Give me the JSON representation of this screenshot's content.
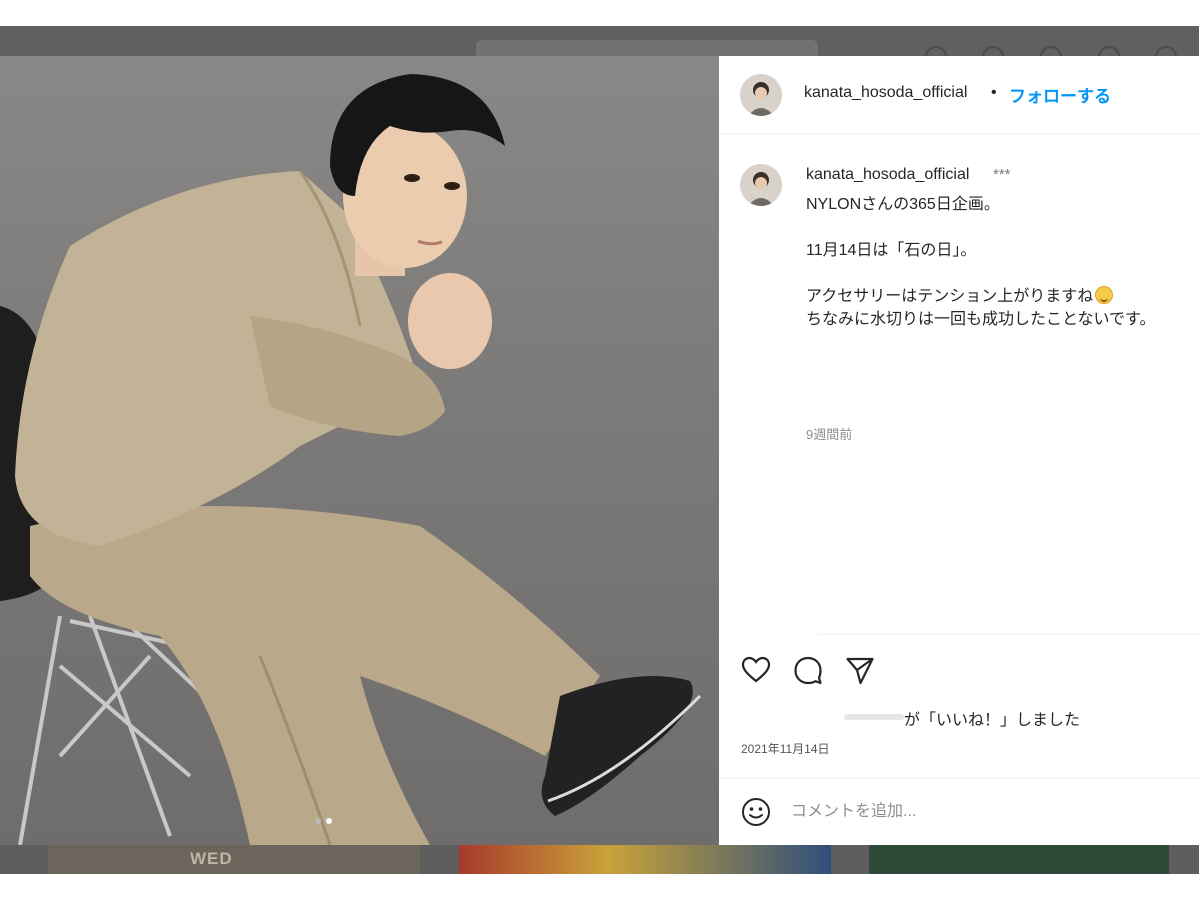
{
  "post": {
    "username": "kanata_hosoda_official",
    "separator": "•",
    "follow_label": "フォローする"
  },
  "caption": {
    "username": "kanata_hosoda_official",
    "stars": "***",
    "lines": [
      "NYLONさんの365日企画。",
      "11月14日は「石の日」。",
      "アクセサリーはテンション上がりますね",
      "ちなみに水切りは一回も成功したことないです。"
    ],
    "time_ago": "9週間前"
  },
  "likes": {
    "text": "が「いいね！」しました"
  },
  "date": "2021年11月14日",
  "comment": {
    "placeholder": "コメントを追加..."
  },
  "background": {
    "thumbnail_text": "WED"
  },
  "carousel": {
    "total": 2,
    "active_index": 1
  },
  "colors": {
    "link": "#0095f6",
    "text": "#262626",
    "muted": "#8e8e8e",
    "backdrop": "#5e5e5e"
  },
  "icons": {
    "like": "heart-icon",
    "comment": "comment-bubble-icon",
    "share": "paper-plane-icon",
    "emoji": "smiley-icon"
  }
}
